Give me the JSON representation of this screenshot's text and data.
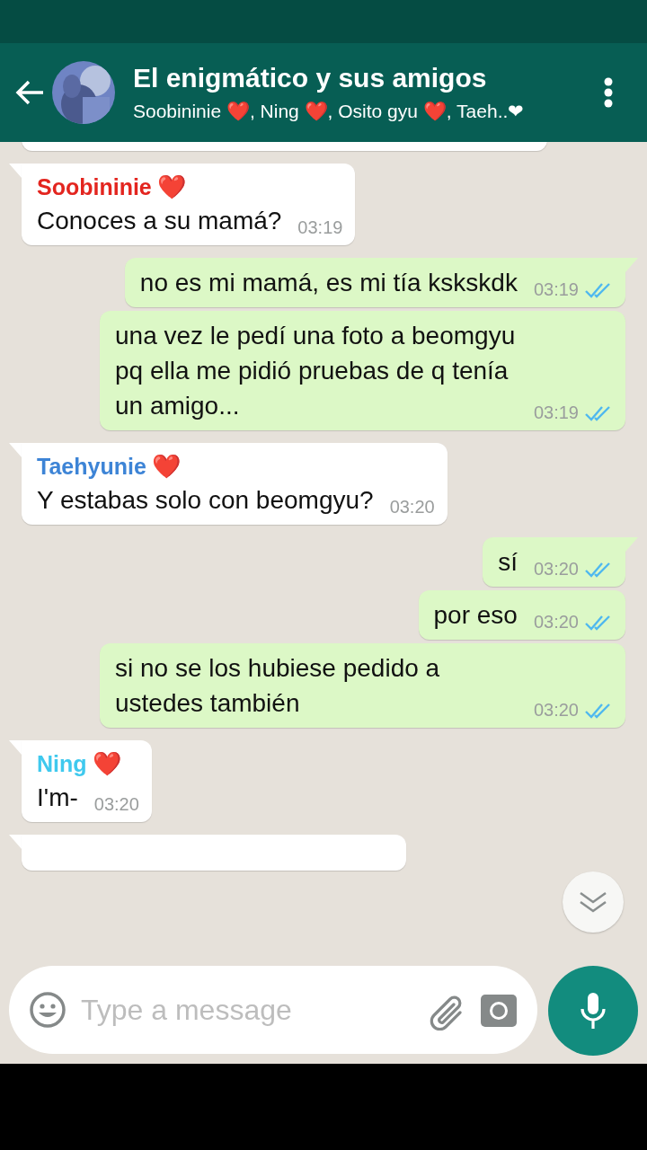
{
  "header": {
    "title": "El enigmático y sus amigos",
    "subtitle": "Soobininie ❤️, Ning ❤️, Osito gyu ❤️, Taeh..❤"
  },
  "messages": [
    {
      "kind": "partial_top"
    },
    {
      "kind": "incoming",
      "tail": true,
      "sender": "Soobininie",
      "emoji": "❤️",
      "color": "#e3251f",
      "text": "Conoces a su mamá?",
      "time": "03:19"
    },
    {
      "kind": "outgoing",
      "tail": true,
      "text": "no es mi mamá, es mi tía kskskdk",
      "time": "03:19",
      "read": true
    },
    {
      "kind": "outgoing",
      "tail": false,
      "text": "una vez le pedí una foto a beomgyu pq ella me pidió pruebas de q tenía un amigo...",
      "time": "03:19",
      "read": true
    },
    {
      "kind": "incoming",
      "tail": true,
      "sender": "Taehyunie",
      "emoji": "❤️",
      "color": "#3d84d6",
      "text": "Y estabas solo con beomgyu?",
      "time": "03:20"
    },
    {
      "kind": "outgoing",
      "tail": true,
      "text": "sí",
      "time": "03:20",
      "read": true
    },
    {
      "kind": "outgoing",
      "tail": false,
      "text": "por eso",
      "time": "03:20",
      "read": true
    },
    {
      "kind": "outgoing",
      "tail": false,
      "text": "si no se los hubiese pedido a ustedes también",
      "time": "03:20",
      "read": true
    },
    {
      "kind": "incoming",
      "tail": true,
      "sender": "Ning",
      "emoji": "❤️",
      "color": "#3fc9ee",
      "text": "I'm-",
      "time": "03:20"
    },
    {
      "kind": "partial_bottom",
      "tail": true
    }
  ],
  "composer": {
    "placeholder": "Type a message"
  }
}
